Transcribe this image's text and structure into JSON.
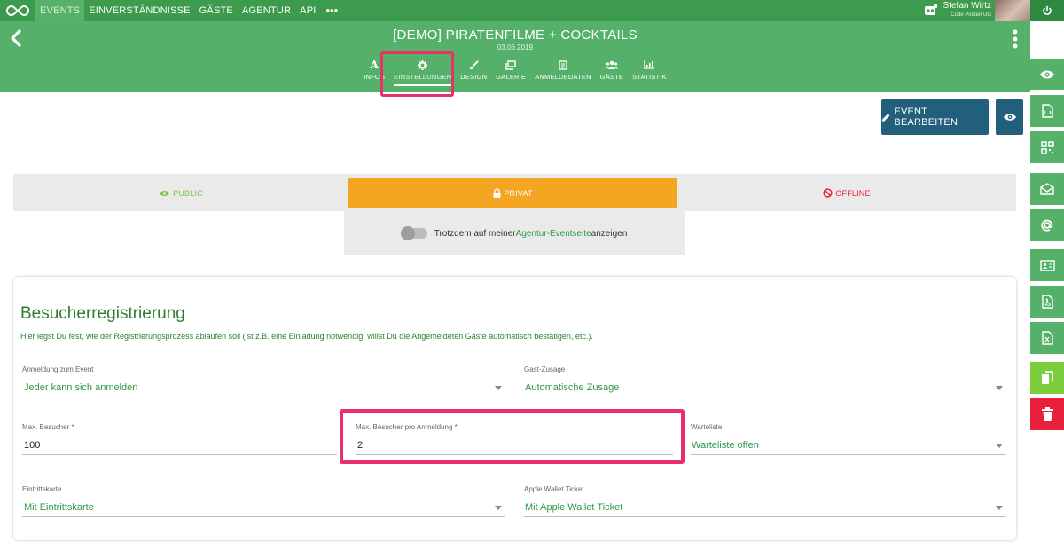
{
  "topnav": {
    "items": [
      {
        "label": "EVENTS",
        "active": true
      },
      {
        "label": "EINVERSTÄNDNISSE",
        "active": false
      },
      {
        "label": "GÄSTE",
        "active": false
      },
      {
        "label": "AGENTUR",
        "active": false
      },
      {
        "label": "API",
        "active": false
      }
    ],
    "more": "•••",
    "user": {
      "name": "Stefan Wirtz",
      "org": "Code Piraten UG"
    }
  },
  "event": {
    "title": "[DEMO] PIRATENFILME + COCKTAILS",
    "date": "03.06.2019",
    "tabs": [
      {
        "label": "INFOS",
        "icon": "letter-a-icon",
        "active": false
      },
      {
        "label": "EINSTELLUNGEN",
        "icon": "gear-icon",
        "active": true
      },
      {
        "label": "DESIGN",
        "icon": "brush-icon",
        "active": false
      },
      {
        "label": "GALERIE",
        "icon": "gallery-icon",
        "active": false
      },
      {
        "label": "ANMELDEDATEN",
        "icon": "form-icon",
        "active": false
      },
      {
        "label": "GÄSTE",
        "icon": "people-icon",
        "active": false
      },
      {
        "label": "STATISTIK",
        "icon": "chart-icon",
        "active": false
      }
    ]
  },
  "actions": {
    "edit_label": "EVENT BEARBEITEN"
  },
  "visibility": {
    "public": "PUBLIC",
    "privat": "PRIVAT",
    "offline": "OFFLINE",
    "toggle_text_before": "Trotzdem auf meiner ",
    "toggle_link": "Agentur-Eventseite",
    "toggle_text_after": " anzeigen"
  },
  "registration": {
    "title": "Besucherregistrierung",
    "description": "Hier legst Du fest, wie der Registrierungsprozess ablaufen soll (ist z.B. eine Einladung notwendig, willst Du die Angemeldeten Gäste automatisch bestätigen, etc.).",
    "fields": {
      "anmeldung": {
        "label": "Anmeldung zum Event",
        "value": "Jeder kann sich anmelden"
      },
      "gast_zusage": {
        "label": "Gast-Zusage",
        "value": "Automatische Zusage"
      },
      "max_besucher": {
        "label": "Max. Besucher *",
        "value": "100"
      },
      "max_pro_anmeldung": {
        "label": "Max. Besucher pro Anmeldung *",
        "value": "2"
      },
      "warteliste": {
        "label": "Warteliste",
        "value": "Warteliste offen"
      },
      "eintrittskarte": {
        "label": "Eintrittskarte",
        "value": "Mit Eintrittskarte"
      },
      "apple_wallet": {
        "label": "Apple Wallet Ticket",
        "value": "Mit Apple Wallet Ticket"
      }
    }
  },
  "colors": {
    "brand_green": "#55b16a",
    "nav_green": "#3d9b4d",
    "privat_orange": "#f4a521",
    "offline_red": "#e8203c",
    "edit_blue": "#215f7d",
    "highlight_pink": "#e8306b"
  }
}
